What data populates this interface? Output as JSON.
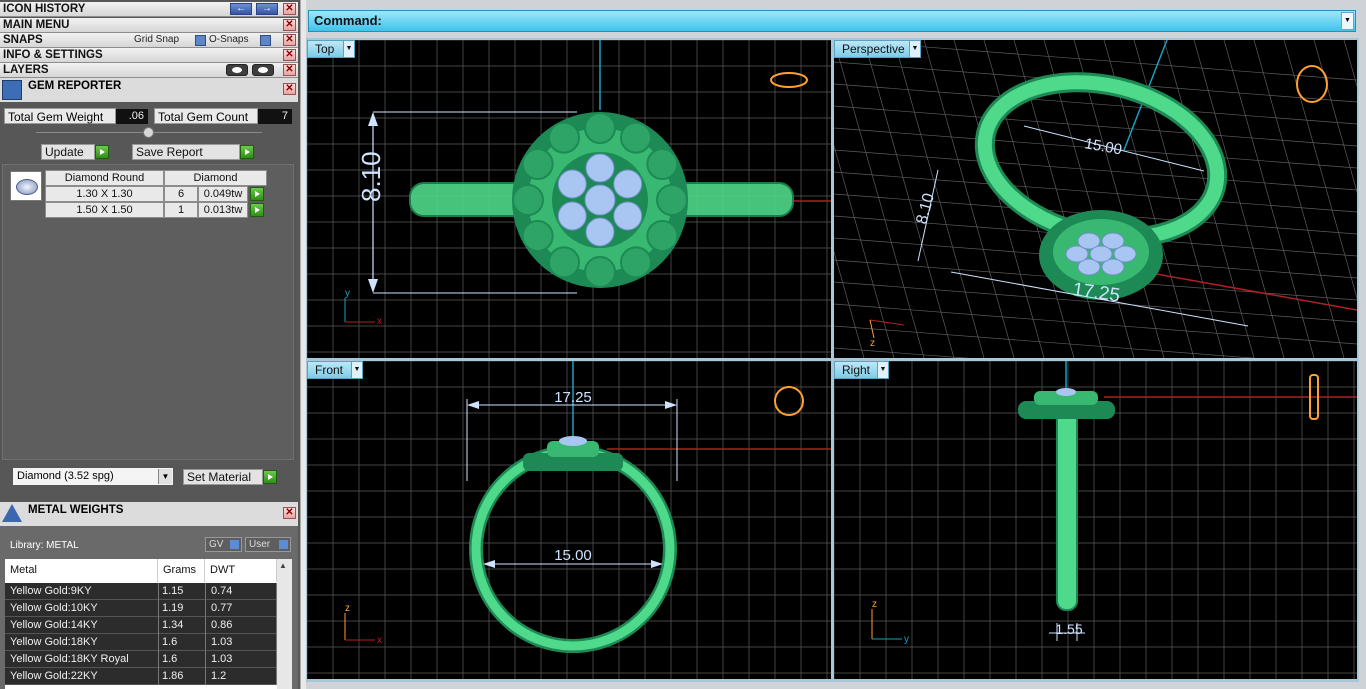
{
  "panels": {
    "icon_history": "ICON HISTORY",
    "main_menu": "MAIN MENU",
    "snaps": "SNAPS",
    "grid_snap": "Grid Snap",
    "o_snaps": "O-Snaps",
    "info_settings": "INFO & SETTINGS",
    "layers": "LAYERS"
  },
  "gem_reporter": {
    "title": "GEM REPORTER",
    "total_weight_label": "Total Gem Weight",
    "total_weight_value": ".06",
    "total_count_label": "Total Gem Count",
    "total_count_value": "7",
    "update_label": "Update",
    "save_report_label": "Save Report",
    "table_header": [
      "Diamond Round",
      "Diamond"
    ],
    "rows": [
      {
        "size": "1.30 X 1.30",
        "count": "6",
        "weight": "0.049tw"
      },
      {
        "size": "1.50 X 1.50",
        "count": "1",
        "weight": "0.013tw"
      }
    ],
    "material_select": "Diamond    (3.52 spg)",
    "set_material_label": "Set Material"
  },
  "metal_weights": {
    "title": "METAL WEIGHTS",
    "library": "Library: METAL",
    "gv_label": "GV",
    "user_label": "User",
    "columns": [
      "Metal",
      "Grams",
      "DWT"
    ],
    "rows": [
      {
        "metal": "Yellow Gold:9KY",
        "grams": "1.15",
        "dwt": "0.74"
      },
      {
        "metal": "Yellow Gold:10KY",
        "grams": "1.19",
        "dwt": "0.77"
      },
      {
        "metal": "Yellow Gold:14KY",
        "grams": "1.34",
        "dwt": "0.86"
      },
      {
        "metal": "Yellow Gold:18KY",
        "grams": "1.6",
        "dwt": "1.03"
      },
      {
        "metal": "Yellow Gold:18KY Royal",
        "grams": "1.6",
        "dwt": "1.03"
      },
      {
        "metal": "Yellow Gold:22KY",
        "grams": "1.86",
        "dwt": "1.2"
      }
    ]
  },
  "command": {
    "label": "Command:"
  },
  "viewports": {
    "top": {
      "name": "Top",
      "dim_vertical": "8.10",
      "axis_y": "y",
      "axis_x": "x"
    },
    "perspective": {
      "name": "Perspective",
      "dim_width": "15.00",
      "dim_height": "8.10",
      "dim_length": "17.25",
      "axis_z": "z"
    },
    "front": {
      "name": "Front",
      "dim_outer": "17.25",
      "dim_inner": "15.00",
      "axis_z": "z",
      "axis_x": "x"
    },
    "right": {
      "name": "Right",
      "dim_shank": "1.55",
      "axis_z": "z",
      "axis_y": "y"
    }
  },
  "colors": {
    "ring_green": "#4fd98a",
    "ring_dark": "#1d8a55",
    "gem_blue": "#a9c6f2",
    "grid": "#5c5c5c",
    "dim_line": "#cfe3ff",
    "axis_red": "#b02020",
    "axis_cyan": "#1aa0c0",
    "tab_blue": "#7ccce8"
  }
}
